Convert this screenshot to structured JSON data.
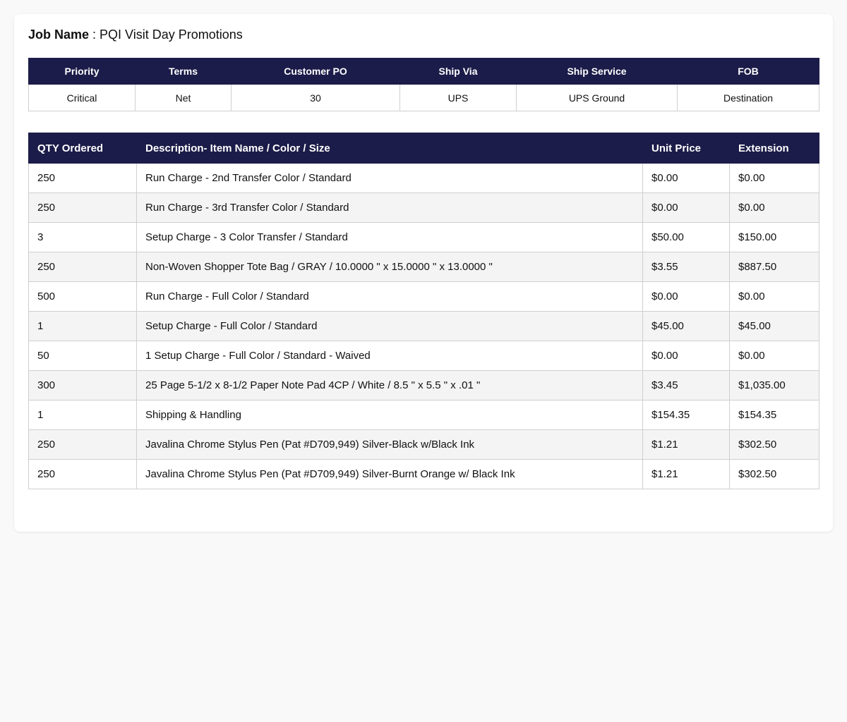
{
  "job": {
    "label": "Job Name",
    "separator": " : ",
    "value": "PQI Visit Day Promotions"
  },
  "order_info": {
    "headers": [
      "Priority",
      "Terms",
      "Customer PO",
      "Ship Via",
      "Ship Service",
      "FOB"
    ],
    "values": [
      "Critical",
      "Net",
      "30",
      "UPS",
      "UPS Ground",
      "Destination"
    ]
  },
  "line_items": {
    "headers": [
      "QTY Ordered",
      "Description- Item Name / Color / Size",
      "Unit Price",
      "Extension"
    ],
    "rows": [
      {
        "qty": "250",
        "description": "Run Charge - 2nd Transfer Color / Standard",
        "unit_price": "$0.00",
        "extension": "$0.00"
      },
      {
        "qty": "250",
        "description": "Run Charge - 3rd Transfer Color / Standard",
        "unit_price": "$0.00",
        "extension": "$0.00"
      },
      {
        "qty": "3",
        "description": "Setup Charge - 3 Color Transfer / Standard",
        "unit_price": "$50.00",
        "extension": "$150.00"
      },
      {
        "qty": "250",
        "description": "Non-Woven Shopper Tote Bag / GRAY / 10.0000 \" x 15.0000 \" x 13.0000 \"",
        "unit_price": "$3.55",
        "extension": "$887.50"
      },
      {
        "qty": "500",
        "description": "Run Charge - Full Color / Standard",
        "unit_price": "$0.00",
        "extension": "$0.00"
      },
      {
        "qty": "1",
        "description": "Setup Charge - Full Color / Standard",
        "unit_price": "$45.00",
        "extension": "$45.00"
      },
      {
        "qty": "50",
        "description": "1 Setup Charge - Full Color / Standard - Waived",
        "unit_price": "$0.00",
        "extension": "$0.00"
      },
      {
        "qty": "300",
        "description": "25 Page 5-1/2 x 8-1/2 Paper Note Pad 4CP / White / 8.5 \" x 5.5 \" x .01 \"",
        "unit_price": "$3.45",
        "extension": "$1,035.00"
      },
      {
        "qty": "1",
        "description": "Shipping & Handling",
        "unit_price": "$154.35",
        "extension": "$154.35"
      },
      {
        "qty": "250",
        "description": "Javalina Chrome Stylus Pen (Pat #D709,949) Silver-Black w/Black Ink",
        "unit_price": "$1.21",
        "extension": "$302.50"
      },
      {
        "qty": "250",
        "description": "Javalina Chrome Stylus Pen (Pat #D709,949) Silver-Burnt Orange w/ Black Ink",
        "unit_price": "$1.21",
        "extension": "$302.50"
      }
    ]
  },
  "colors": {
    "header_bg": "#1c1c4a",
    "header_text": "#ffffff",
    "row_alt_bg": "#f4f4f4",
    "border": "#cfcfcf"
  }
}
